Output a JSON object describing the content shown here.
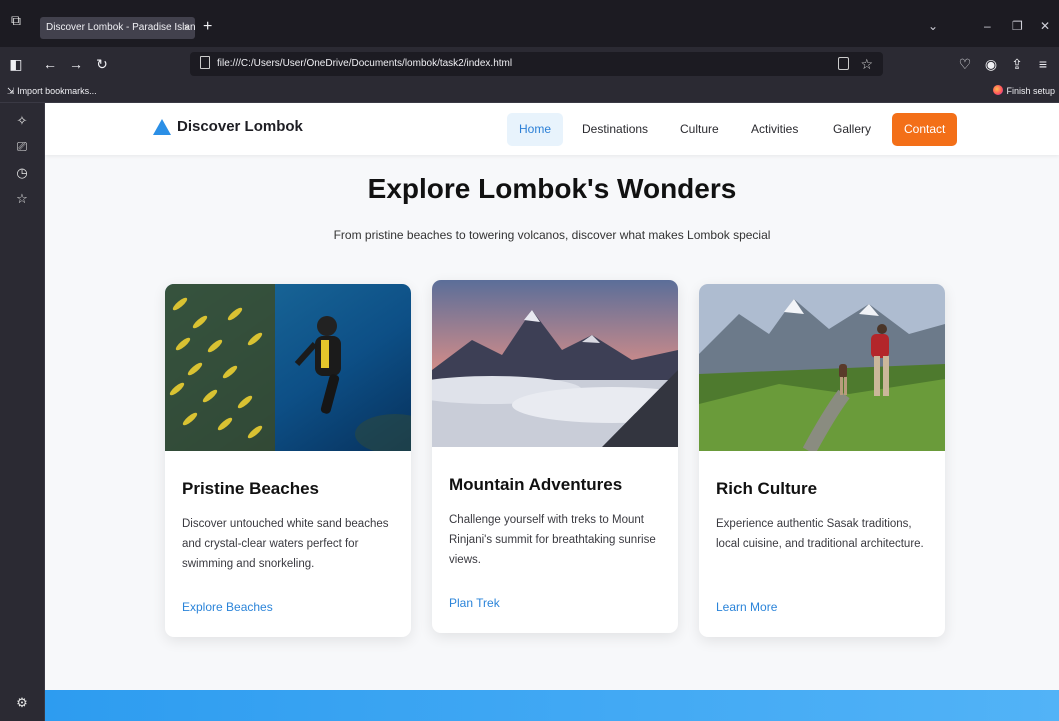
{
  "browser": {
    "tab_title": "Discover Lombok - Paradise Island",
    "tab_close": "×",
    "new_tab": "+",
    "url": "file:///C:/Users/User/OneDrive/Documents/lombok/task2/index.html",
    "bookmarks_import": "Import bookmarks...",
    "finish_setup": "Finish setup",
    "icons": {
      "tab_list": "tab-list-icon",
      "back": "back-arrow-icon",
      "forward": "forward-arrow-icon",
      "reload": "reload-icon",
      "sidebar_toggle": "sidebar-toggle-icon",
      "pocket": "pocket-icon",
      "account": "account-icon",
      "extensions": "extensions-icon",
      "menu": "hamburger-menu-icon"
    }
  },
  "site": {
    "logo_text": "Discover Lombok",
    "nav": {
      "home": "Home",
      "destinations": "Destinations",
      "culture": "Culture",
      "activities": "Activities",
      "gallery": "Gallery",
      "contact": "Contact"
    },
    "hero": {
      "title": "Explore Lombok's Wonders",
      "subtitle": "From pristine beaches to towering volcanos, discover what makes Lombok special"
    },
    "cards": [
      {
        "title": "Pristine Beaches",
        "description": "Discover untouched white sand beaches and crystal-clear waters perfect for swimming and snorkeling.",
        "link": "Explore Beaches"
      },
      {
        "title": "Mountain Adventures",
        "description": "Challenge yourself with treks to Mount Rinjani's summit for breathtaking sunrise views.",
        "link": "Plan Trek"
      },
      {
        "title": "Rich Culture",
        "description": "Experience authentic Sasak traditions, local cuisine, and traditional architecture.",
        "link": "Learn More"
      }
    ]
  },
  "colors": {
    "accent_orange": "#f36f18",
    "link_blue": "#2b84d9",
    "footer_blue": "#2d9cf0"
  }
}
